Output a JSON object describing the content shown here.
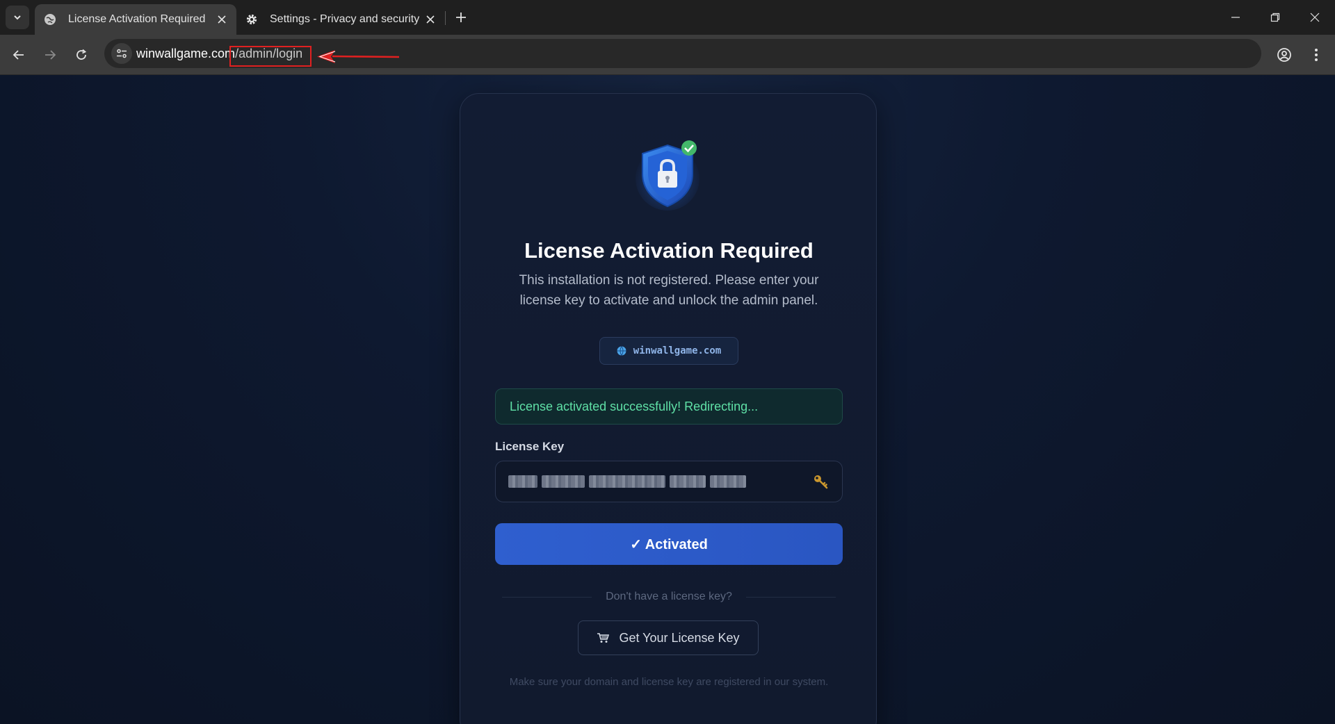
{
  "browser": {
    "tabs": [
      {
        "title": "License Activation Required",
        "icon": "globe-icon",
        "active": true
      },
      {
        "title": "Settings - Privacy and security",
        "icon": "gear-icon",
        "active": false
      }
    ],
    "url": {
      "host": "winwallgame.com",
      "path": "/admin/login"
    }
  },
  "page": {
    "title": "License Activation Required",
    "subtitle": "This installation is not registered. Please enter your license key to activate and unlock the admin panel.",
    "domain_badge": "winwallgame.com",
    "alert": "License activated successfully! Redirecting...",
    "license_label": "License Key",
    "activate_button": "✓ Activated",
    "divider_text": "Don't have a license key?",
    "get_key_button": "Get Your License Key",
    "footnote": "Make sure your domain and license key are registered in our system."
  },
  "colors": {
    "accent": "#2f5fcf",
    "success": "#5fe0a6",
    "background": "#0c1424",
    "annotation": "#e02020"
  }
}
